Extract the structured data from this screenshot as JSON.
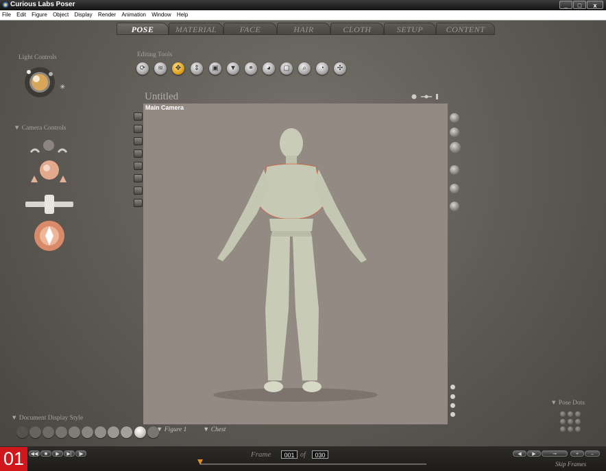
{
  "app": {
    "title": "Curious Labs Poser"
  },
  "window_buttons": [
    "_",
    "□",
    "x"
  ],
  "menu": [
    "File",
    "Edit",
    "Figure",
    "Object",
    "Display",
    "Render",
    "Animation",
    "Window",
    "Help"
  ],
  "tabs": [
    {
      "label": "POSE",
      "active": true
    },
    {
      "label": "MATERIAL",
      "active": false
    },
    {
      "label": "FACE",
      "active": false
    },
    {
      "label": "HAIR",
      "active": false
    },
    {
      "label": "CLOTH",
      "active": false
    },
    {
      "label": "SETUP",
      "active": false
    },
    {
      "label": "CONTENT",
      "active": false
    }
  ],
  "panels": {
    "light_controls": "Light Controls",
    "camera_controls": "Camera Controls",
    "editing_tools": "Editing Tools",
    "document_display_style": "Document Display Style",
    "pose_dots": "Pose Dots"
  },
  "editing_tools": [
    {
      "name": "rotate-tool-icon",
      "glyph": "⟳",
      "active": false
    },
    {
      "name": "twist-tool-icon",
      "glyph": "≋",
      "active": false
    },
    {
      "name": "translate-tool-icon",
      "glyph": "✥",
      "active": true
    },
    {
      "name": "translate-in-out-tool-icon",
      "glyph": "⇕",
      "active": false
    },
    {
      "name": "scale-tool-icon",
      "glyph": "▣",
      "active": false
    },
    {
      "name": "taper-tool-icon",
      "glyph": "▼",
      "active": false
    },
    {
      "name": "chain-break-tool-icon",
      "glyph": "⚭",
      "active": false
    },
    {
      "name": "color-tool-icon",
      "glyph": "◕",
      "active": false
    },
    {
      "name": "grouping-tool-icon",
      "glyph": "▢",
      "active": false
    },
    {
      "name": "view-magnifier-tool-icon",
      "glyph": "⌕",
      "active": false
    },
    {
      "name": "morphing-tool-icon",
      "glyph": "◔",
      "active": false
    },
    {
      "name": "direct-manipulation-tool-icon",
      "glyph": "✣",
      "active": false
    }
  ],
  "document": {
    "title": "Untitled",
    "camera_label": "Main Camera"
  },
  "selectors": {
    "figure": "Figure 1",
    "body_part": "Chest"
  },
  "timeline": {
    "frame_label": "Frame",
    "current_frame": "001",
    "of_label": "of",
    "total_frames": "030",
    "skip_frames_label": "Skip Frames"
  },
  "playback_left": [
    "◀◀",
    "■",
    "▶",
    "▶|",
    "|▶"
  ],
  "playback_right": [
    "◀",
    "▶",
    "⊸",
    "+",
    "–"
  ],
  "badge": "01",
  "colors": {
    "viewport_bg": "#948a84",
    "active_tool": "#e0a020",
    "badge": "#d0171b"
  }
}
